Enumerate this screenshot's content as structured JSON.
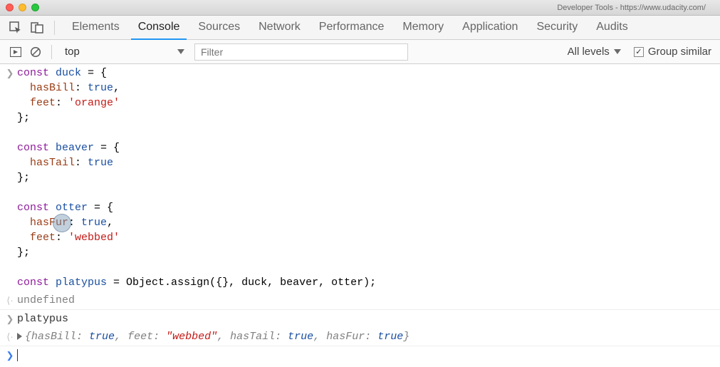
{
  "window": {
    "title": "Developer Tools - https://www.udacity.com/"
  },
  "tabs": {
    "items": [
      "Elements",
      "Console",
      "Sources",
      "Network",
      "Performance",
      "Memory",
      "Application",
      "Security",
      "Audits"
    ],
    "active": "Console"
  },
  "toolbar": {
    "context": "top",
    "filter_placeholder": "Filter",
    "levels": "All levels",
    "group_label": "Group similar",
    "group_checked": true
  },
  "console": {
    "input1": {
      "duck": {
        "kw": "const",
        "name": "duck",
        "open": " = {",
        "p1": "hasBill",
        "v1": "true",
        "p2": "feet",
        "v2": "'orange'",
        "close": "};"
      },
      "beaver": {
        "kw": "const",
        "name": "beaver",
        "open": " = {",
        "p1": "hasTail",
        "v1": "true",
        "close": "};"
      },
      "otter": {
        "kw": "const",
        "name": "otter",
        "open": " = {",
        "p1": "hasFur",
        "v1": "true",
        "p2": "feet",
        "v2": "'webbed'",
        "close": "};"
      },
      "platypus": {
        "kw": "const",
        "name": "platypus",
        "rhs": " = Object.assign({}, duck, beaver, otter);"
      }
    },
    "result1": "undefined",
    "input2": "platypus",
    "result2": {
      "prefix": "{",
      "k1": "hasBill",
      "v1": "true",
      "k2": "feet",
      "v2": "\"webbed\"",
      "k3": "hasTail",
      "v3": "true",
      "k4": "hasFur",
      "v4": "true",
      "suffix": "}"
    }
  }
}
